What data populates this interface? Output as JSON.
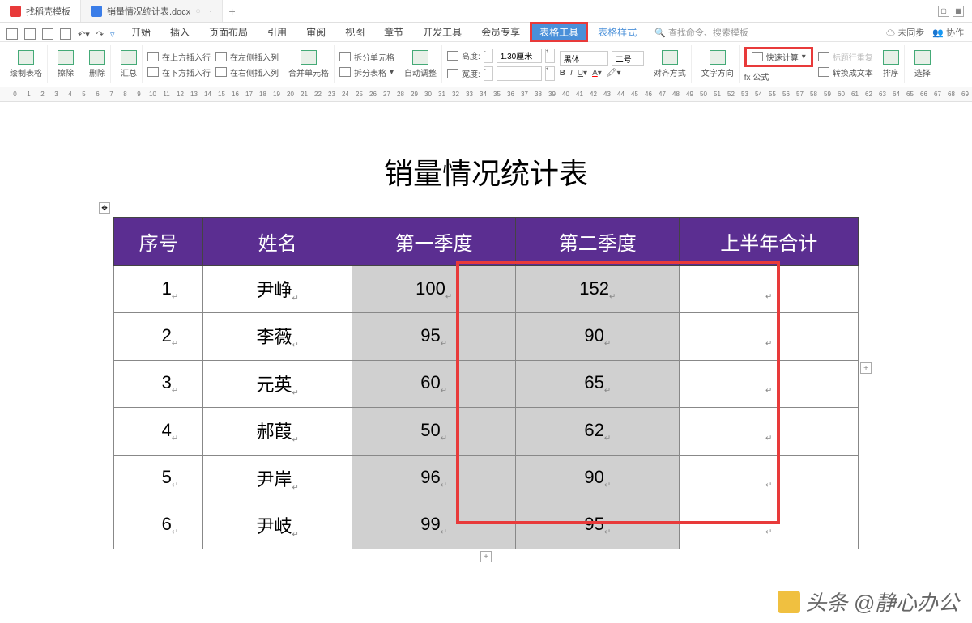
{
  "tabs": {
    "t1": "找稻壳模板",
    "t2": "销量情况统计表.docx"
  },
  "menu": {
    "items": [
      "开始",
      "插入",
      "页面布局",
      "引用",
      "审阅",
      "视图",
      "章节",
      "开发工具",
      "会员专享"
    ],
    "table_tools": "表格工具",
    "table_style": "表格样式",
    "search": "查找命令、搜索模板",
    "unsync": "未同步",
    "collab": "协作"
  },
  "ribbon": {
    "draw_table": "绘制表格",
    "eraser": "擦除",
    "delete": "删除",
    "summary": "汇总",
    "ins_above": "在上方插入行",
    "ins_left": "在左侧插入列",
    "ins_below": "在下方插入行",
    "ins_right": "在右侧插入列",
    "merge": "合并单元格",
    "split_cell": "拆分单元格",
    "split_table": "拆分表格",
    "autofit": "自动调整",
    "height": "高度:",
    "width": "宽度:",
    "height_val": "1.30厘米",
    "font": "黑体",
    "size": "二号",
    "align": "对齐方式",
    "text_dir": "文字方向",
    "formula": "fx 公式",
    "quick_calc": "快速计算",
    "convert": "转换成文本",
    "sort": "排序",
    "repeat_header": "标题行重复",
    "select": "选择"
  },
  "doc": {
    "title": "销量情况统计表",
    "headers": [
      "序号",
      "姓名",
      "第一季度",
      "第二季度",
      "上半年合计"
    ],
    "rows": [
      {
        "n": "1",
        "name": "尹峥",
        "q1": "100",
        "q2": "152",
        "sum": ""
      },
      {
        "n": "2",
        "name": "李薇",
        "q1": "95",
        "q2": "90",
        "sum": ""
      },
      {
        "n": "3",
        "name": "元英",
        "q1": "60",
        "q2": "65",
        "sum": ""
      },
      {
        "n": "4",
        "name": "郝葭",
        "q1": "50",
        "q2": "62",
        "sum": ""
      },
      {
        "n": "5",
        "name": "尹岸",
        "q1": "96",
        "q2": "90",
        "sum": ""
      },
      {
        "n": "6",
        "name": "尹岐",
        "q1": "99",
        "q2": "95",
        "sum": ""
      }
    ]
  },
  "watermark": "头条 @静心办公"
}
